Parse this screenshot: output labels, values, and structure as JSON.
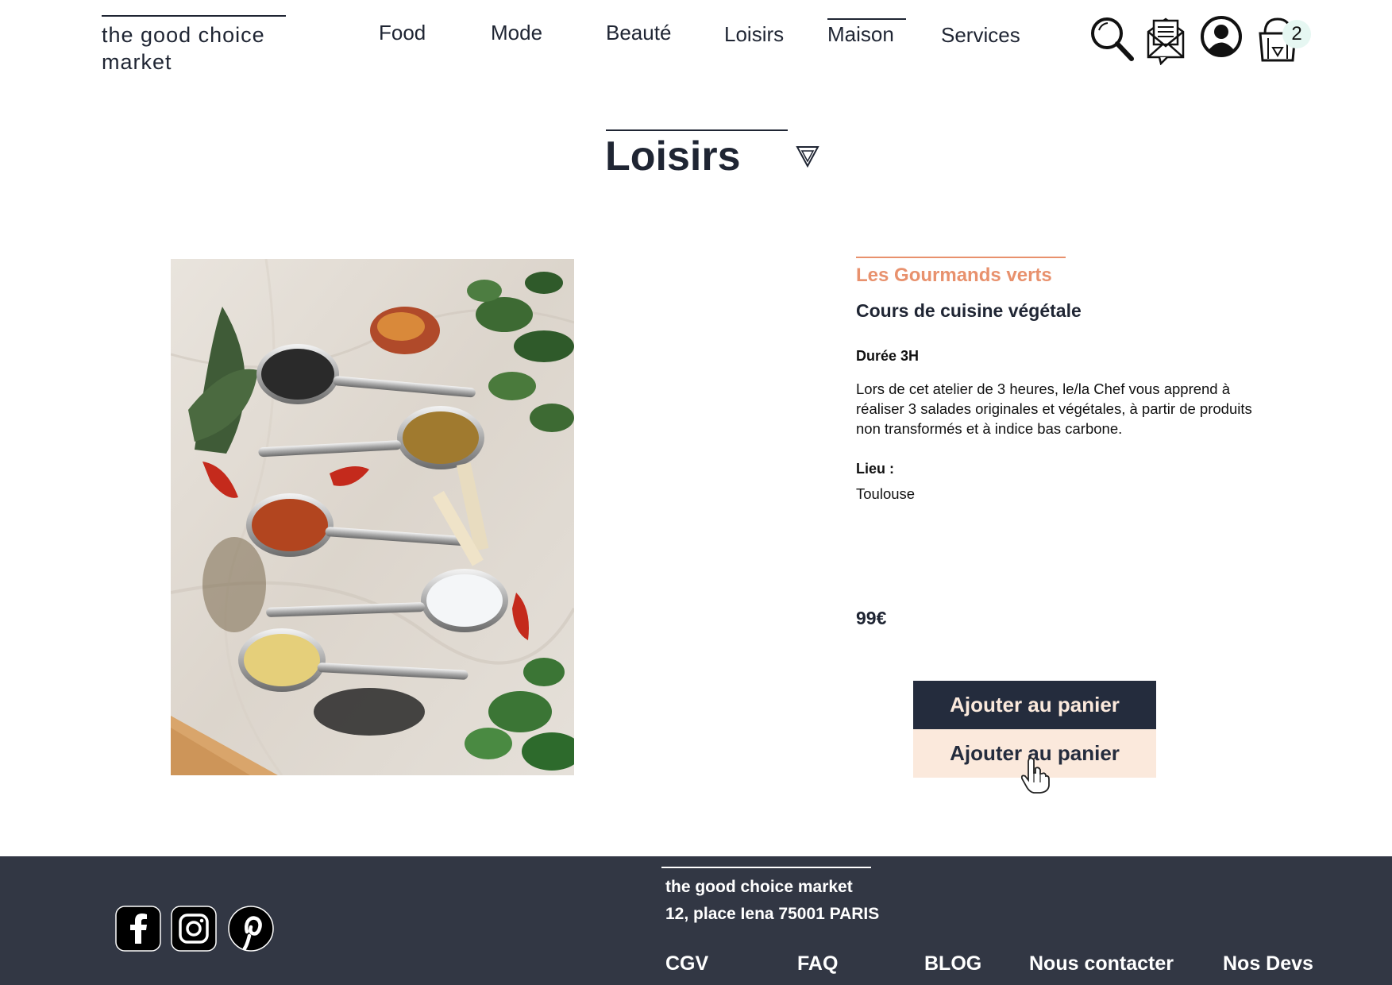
{
  "brand": {
    "line1": "the good choice",
    "line2": "market"
  },
  "nav": {
    "items": [
      {
        "label": "Food",
        "active": false
      },
      {
        "label": "Mode",
        "active": false
      },
      {
        "label": "Beauté",
        "active": false
      },
      {
        "label": "Loisirs",
        "active": false
      },
      {
        "label": "Maison",
        "active": true
      },
      {
        "label": "Services",
        "active": false
      }
    ]
  },
  "header_icons": {
    "search": "search-icon",
    "messages": "mail-icon",
    "account": "user-account-icon",
    "cart": "shopping-basket-icon",
    "cart_count": "2"
  },
  "page": {
    "title": "Loisirs",
    "dropdown_icon": "chevron-down-triangle-icon"
  },
  "product": {
    "image_alt": "spices in spoons",
    "vendor": "Les Gourmands verts",
    "name": "Cours de cuisine végétale",
    "duration": "Durée 3H",
    "description": "Lors de cet atelier de 3 heures, le/la Chef vous apprend à réaliser 3 salades originales et végétales, à partir de produits non transformés et à indice bas carbone.",
    "place_label": "Lieu :",
    "place_value": "Toulouse",
    "price": "99€",
    "add_to_cart_label": "Ajouter au panier",
    "add_to_cart_hover_label": "Ajouter au panier"
  },
  "footer": {
    "brand": "the good choice market",
    "address": "12, place Iena 75001 PARIS",
    "social": [
      "facebook-icon",
      "instagram-icon",
      "pinterest-icon"
    ],
    "links": [
      "CGV",
      "FAQ",
      "BLOG",
      "Nous contacter",
      "Nos Devs"
    ]
  },
  "colors": {
    "primary": "#1f2533",
    "accent": "#e8916d",
    "cream": "#fbe9dc",
    "footer_bg": "#323744"
  }
}
